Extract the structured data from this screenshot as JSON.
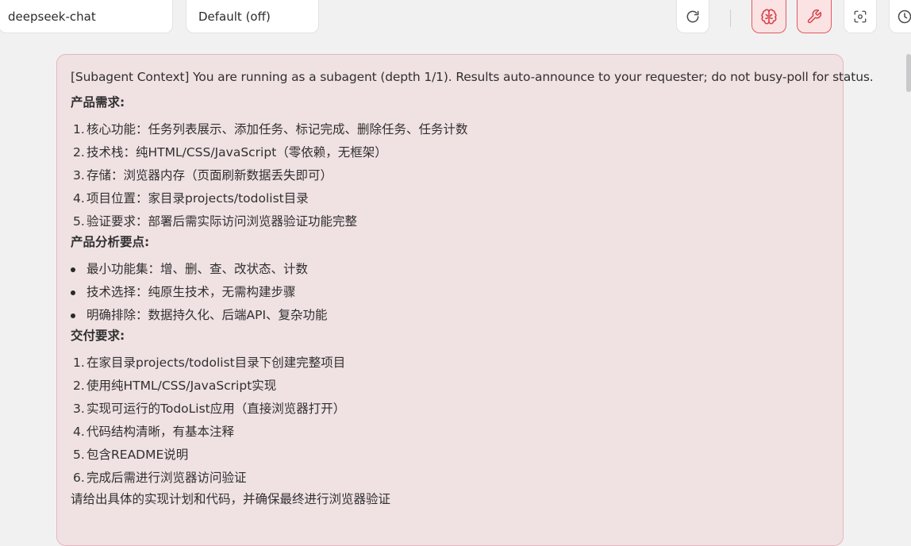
{
  "toolbar": {
    "model_selector": "deepseek-chat",
    "mode_selector": "Default (off)",
    "icons": [
      "refresh-icon",
      "brain-icon",
      "wrench-icon",
      "screenshot-icon",
      "history-icon"
    ],
    "accent_color": "#e0595e"
  },
  "message": {
    "context_line": "[Subagent Context] You are running as a subagent (depth 1/1). Results auto-announce to your requester; do not busy-poll for status.",
    "sections": [
      {
        "heading": "产品需求:",
        "list_type": "ordered",
        "items": [
          "核心功能：任务列表展示、添加任务、标记完成、删除任务、任务计数",
          "技术栈：纯HTML/CSS/JavaScript（零依赖，无框架）",
          "存储：浏览器内存（页面刷新数据丢失即可）",
          "项目位置：家目录projects/todolist目录",
          "验证要求：部署后需实际访问浏览器验证功能完整"
        ]
      },
      {
        "heading": "产品分析要点:",
        "list_type": "unordered",
        "items": [
          "最小功能集：增、删、查、改状态、计数",
          "技术选择：纯原生技术，无需构建步骤",
          "明确排除：数据持久化、后端API、复杂功能"
        ]
      },
      {
        "heading": "交付要求:",
        "list_type": "ordered",
        "items": [
          "在家目录projects/todolist目录下创建完整项目",
          "使用纯HTML/CSS/JavaScript实现",
          "实现可运行的TodoList应用（直接浏览器打开）",
          "代码结构清晰，有基本注释",
          "包含README说明",
          "完成后需进行浏览器访问验证"
        ]
      }
    ],
    "trailing_line": "请给出具体的实现计划和代码，并确保最终进行浏览器验证"
  }
}
